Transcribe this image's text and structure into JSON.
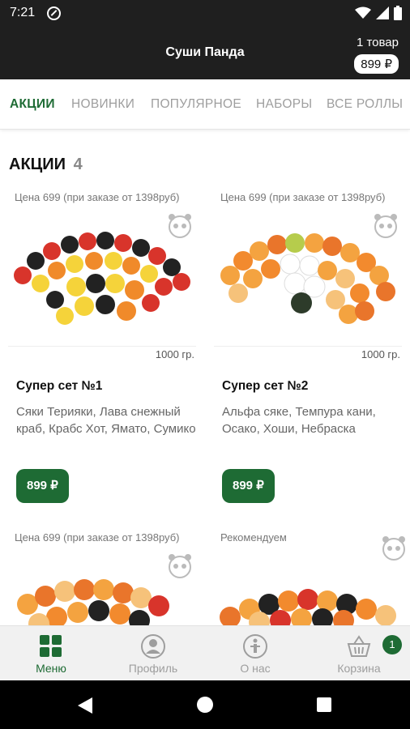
{
  "status_bar": {
    "time": "7:21"
  },
  "app_bar": {
    "title": "Суши Панда",
    "cart_count": "1 товар",
    "cart_total": "899 ₽"
  },
  "tabs": [
    {
      "label": "АКЦИИ"
    },
    {
      "label": "НОВИНКИ"
    },
    {
      "label": "ПОПУЛЯРНОЕ"
    },
    {
      "label": "НАБОРЫ"
    },
    {
      "label": "ВСЕ РОЛЛЫ"
    }
  ],
  "section": {
    "title": "АКЦИИ",
    "count": "4"
  },
  "products": [
    {
      "note": "Цена 699 (при заказе от 1398руб)",
      "weight": "1000 гр.",
      "name": "Супер сет №1",
      "description": "Сяки Терияки, Лава снежный краб, Крабс Хот, Ямато, Сумико",
      "price": "899 ₽"
    },
    {
      "note": "Цена 699 (при заказе от 1398руб)",
      "weight": "1000 гр.",
      "name": "Супер сет №2",
      "description": "Альфа сяке, Темпура кани, Осако, Хоши, Небраска",
      "price": "899 ₽"
    },
    {
      "note": "Цена 699 (при заказе от 1398руб)"
    },
    {
      "note": "Рекомендуем"
    }
  ],
  "bottom_nav": [
    {
      "label": "Меню",
      "icon": "grid-icon"
    },
    {
      "label": "Профиль",
      "icon": "profile-icon"
    },
    {
      "label": "О нас",
      "icon": "info-icon"
    },
    {
      "label": "Корзина",
      "icon": "basket-icon",
      "badge": "1"
    }
  ],
  "colors": {
    "accent": "#1e6b34",
    "bar": "#1f1f1f",
    "inactive": "#9e9e9e"
  }
}
